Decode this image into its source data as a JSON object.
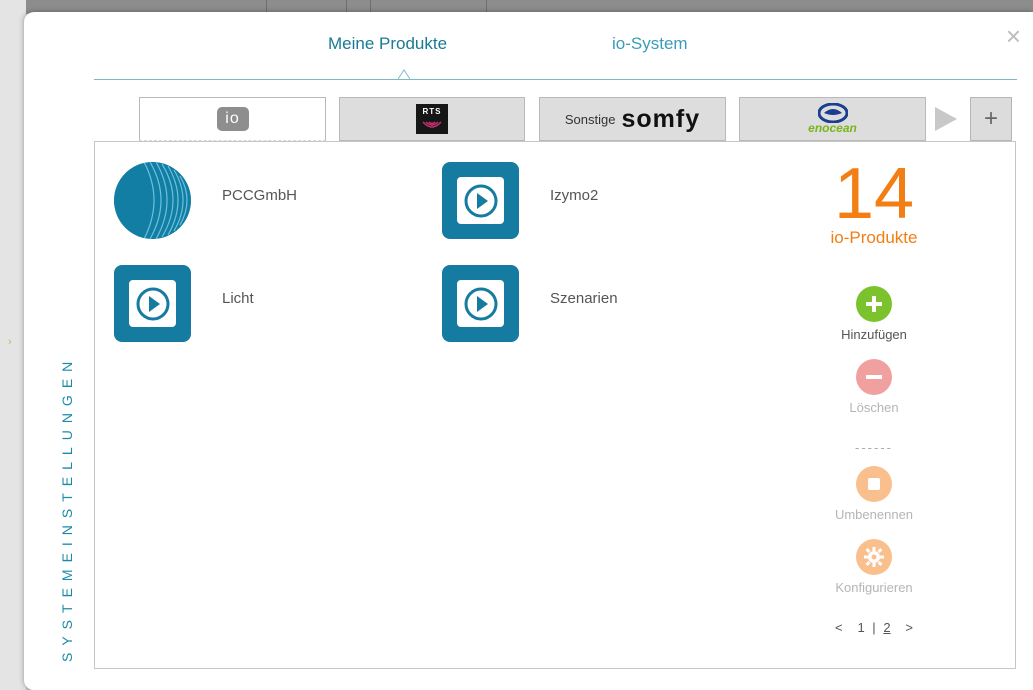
{
  "window": {
    "section_title": "SYSTEMEINSTELLUNGEN",
    "close_label": "×"
  },
  "tabs": [
    {
      "label": "Meine Produkte",
      "active": true
    },
    {
      "label": "io-System",
      "active": false
    }
  ],
  "subtabs": [
    {
      "id": "io",
      "logo_text": "io",
      "active": true
    },
    {
      "id": "rts",
      "logo_text": "RTS",
      "active": false
    },
    {
      "id": "somfy",
      "prefix": "Sonstige",
      "logo_text": "somfy",
      "active": false
    },
    {
      "id": "enocean",
      "logo_text": "enocean",
      "active": false
    }
  ],
  "subtab_controls": {
    "next_icon": "play-right-icon",
    "add_label": "+"
  },
  "products": [
    {
      "name": "PCCGmbH",
      "icon": "round-logo-icon"
    },
    {
      "name": "Izymo2",
      "icon": "play-icon"
    },
    {
      "name": "Licht",
      "icon": "play-icon"
    },
    {
      "name": "Szenarien",
      "icon": "play-icon"
    }
  ],
  "summary": {
    "count": "14",
    "label": "io-Produkte"
  },
  "actions": [
    {
      "label": "Hinzufügen",
      "icon": "plus-circle-icon",
      "color": "#7cc22d",
      "enabled": true
    },
    {
      "label": "Löschen",
      "icon": "minus-circle-icon",
      "color": "#f1a0a0",
      "enabled": false
    },
    {
      "label": "Umbenennen",
      "icon": "stop-circle-icon",
      "color": "#f9c08d",
      "enabled": false
    },
    {
      "label": "Konfigurieren",
      "icon": "gear-circle-icon",
      "color": "#f9c08d",
      "enabled": false
    }
  ],
  "separator": "------",
  "pagination": {
    "prev": "<",
    "pages": [
      "1",
      "2"
    ],
    "current": "2",
    "divider": "|",
    "next": ">"
  },
  "colors": {
    "accent": "#1a7a93",
    "orange": "#f27e14",
    "product_blue": "#157ba0"
  }
}
